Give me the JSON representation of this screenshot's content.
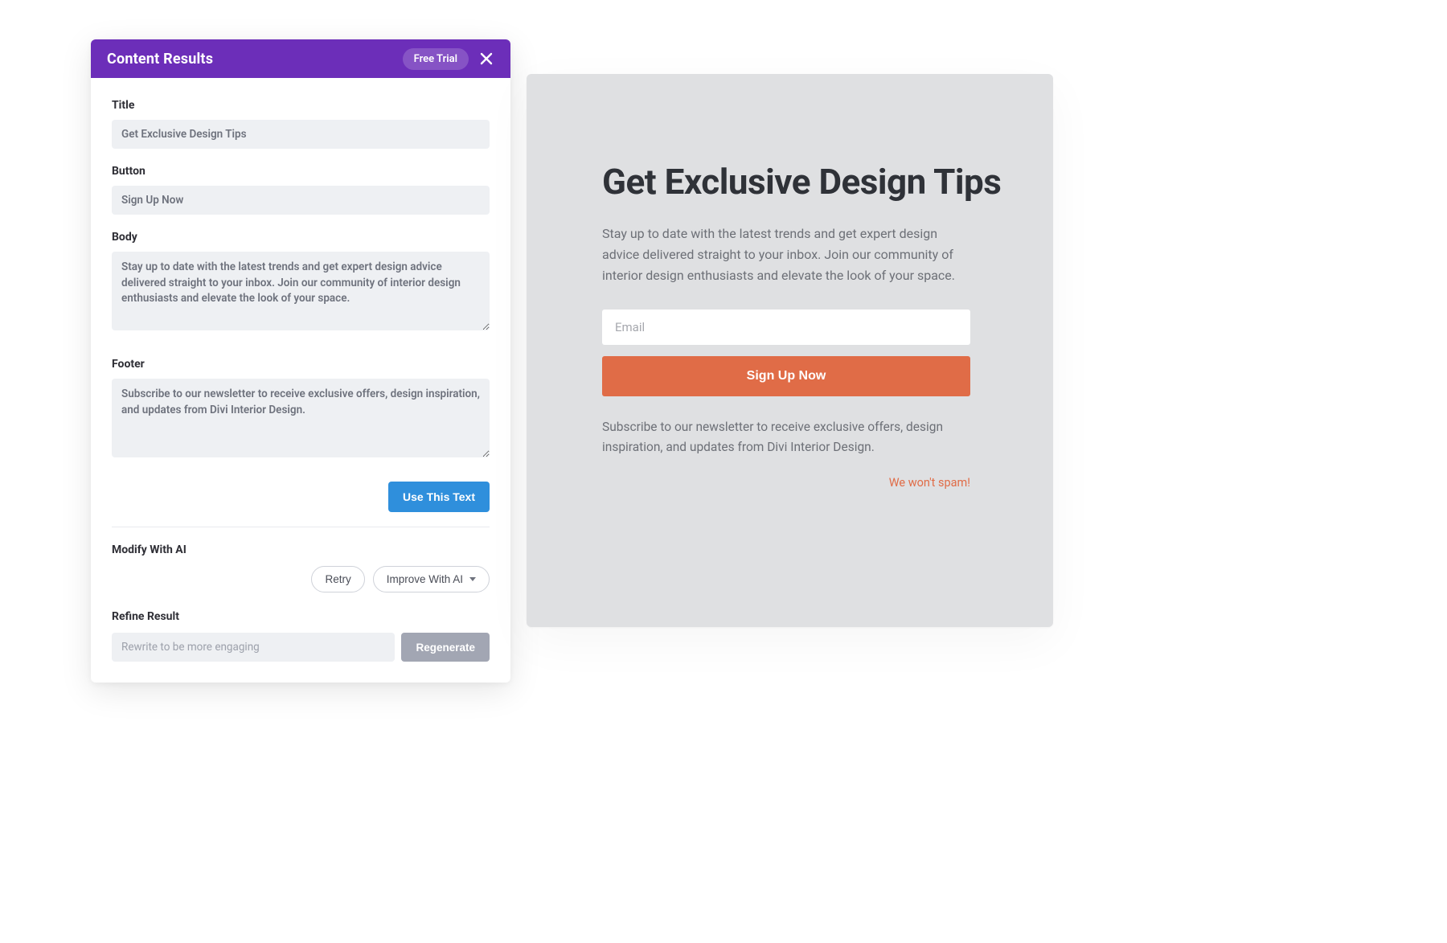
{
  "panel": {
    "header_title": "Content Results",
    "free_trial_label": "Free Trial",
    "fields": {
      "title_label": "Title",
      "title_value": "Get Exclusive Design Tips",
      "button_label": "Button",
      "button_value": "Sign Up Now",
      "body_label": "Body",
      "body_value": "Stay up to date with the latest trends and get expert design advice delivered straight to your inbox. Join our community of interior design enthusiasts and elevate the look of your space.",
      "footer_label": "Footer",
      "footer_value": "Subscribe to our newsletter to receive exclusive offers, design inspiration, and updates from Divi Interior Design."
    },
    "use_text_label": "Use This Text",
    "modify_label": "Modify With AI",
    "retry_label": "Retry",
    "improve_label": "Improve With AI",
    "refine_label": "Refine Result",
    "refine_placeholder": "Rewrite to be more engaging",
    "regenerate_label": "Regenerate"
  },
  "preview": {
    "heading": "Get Exclusive Design Tips",
    "body": "Stay up to date with the latest trends and get expert design advice delivered straight to your inbox. Join our community of interior design enthusiasts and elevate the look of your space.",
    "email_placeholder": "Email",
    "signup_label": "Sign Up Now",
    "footer": "Subscribe to our newsletter to receive exclusive offers, design inspiration, and updates from Divi Interior Design.",
    "no_spam": "We won't spam!"
  }
}
